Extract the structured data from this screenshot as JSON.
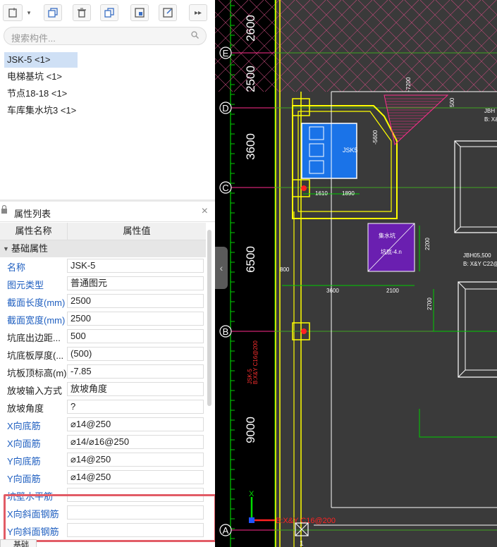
{
  "toolbar": {
    "buttons": [
      "new-component-icon",
      "dropdown-icon",
      "copy-icon",
      "delete-icon",
      "layer-copy-icon",
      "save-template-icon",
      "export-icon",
      "more-icon"
    ]
  },
  "search": {
    "placeholder": "搜索构件..."
  },
  "component_list": [
    {
      "label": "JSK-5 <1>",
      "selected": true
    },
    {
      "label": "电梯基坑 <1>",
      "selected": false
    },
    {
      "label": "节点18-18 <1>",
      "selected": false
    },
    {
      "label": "车库集水坑3 <1>",
      "selected": false
    }
  ],
  "properties": {
    "title": "属性列表",
    "col_name": "属性名称",
    "col_value": "属性值",
    "group": "基础属性",
    "rows": [
      {
        "name": "名称",
        "value": "JSK-5",
        "blue": true
      },
      {
        "name": "图元类型",
        "value": "普通图元",
        "blue": true
      },
      {
        "name": "截面长度(mm)",
        "value": "2500",
        "blue": true
      },
      {
        "name": "截面宽度(mm)",
        "value": "2500",
        "blue": true
      },
      {
        "name": "坑底出边距...",
        "value": "500",
        "blue": false
      },
      {
        "name": "坑底板厚度(...",
        "value": "(500)",
        "blue": false
      },
      {
        "name": "坑板顶标高(m)",
        "value": "-7.85",
        "blue": false
      },
      {
        "name": "放坡输入方式",
        "value": "放坡角度",
        "blue": false
      },
      {
        "name": "放坡角度",
        "value": "?",
        "blue": false
      },
      {
        "name": "X向底筋",
        "value": "⌀14@250",
        "blue": true
      },
      {
        "name": "X向面筋",
        "value": "⌀14/⌀16@250",
        "blue": true
      },
      {
        "name": "Y向底筋",
        "value": "⌀14@250",
        "blue": true
      },
      {
        "name": "Y向面筋",
        "value": "⌀14@250",
        "blue": true
      },
      {
        "name": "坑壁水平筋",
        "value": "",
        "blue": true
      },
      {
        "name": "X向斜面钢筋",
        "value": "",
        "blue": true
      },
      {
        "name": "Y向斜面钢筋",
        "value": "",
        "blue": true
      }
    ],
    "bottom_tab": "基础图"
  },
  "cad": {
    "axes": [
      {
        "label": "E",
        "span_above": "2600"
      },
      {
        "label": "D",
        "span_above": "2500"
      },
      {
        "label": "C",
        "span_above": "3600"
      },
      {
        "label": "B",
        "span_above": "6500"
      },
      {
        "label": "A",
        "span_above": "9000"
      }
    ],
    "texts": [
      "JSK5",
      "800",
      "1610",
      "1890",
      "3600",
      "2100",
      "2200",
      "2700",
      "500",
      "-5600",
      "-7200",
      "JBH05,500",
      "B: X&Y C22@15",
      "JBH",
      "B: X&Y",
      "集水坑",
      "坑底-4.n",
      "JSK-5",
      "B:X&Y C16@200",
      "X",
      "Y",
      "1"
    ],
    "colors": {
      "background": "#3a3a3a",
      "axis": "#ffff00",
      "grid": "#00cc00",
      "magenta": "#ff2d8c",
      "white": "#ffffff"
    }
  }
}
